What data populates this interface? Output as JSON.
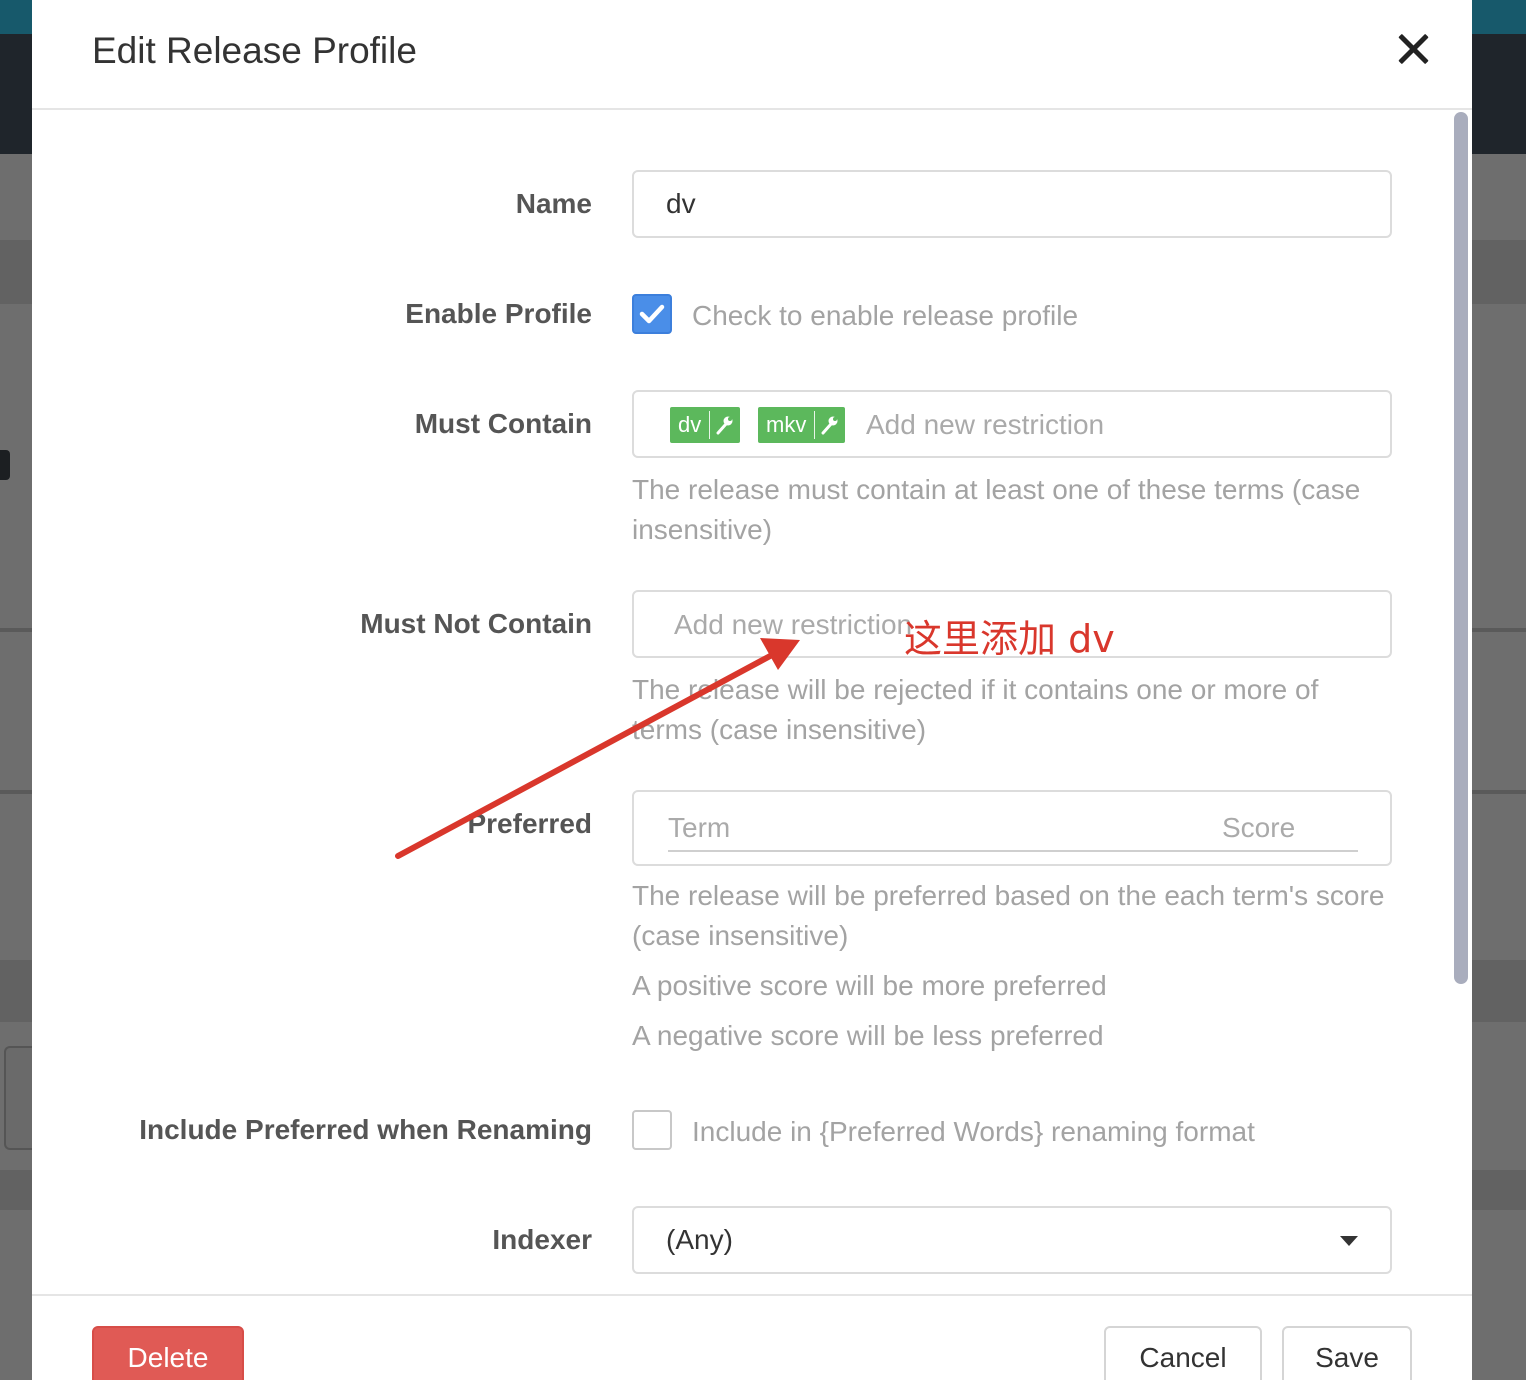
{
  "modal": {
    "title": "Edit Release Profile"
  },
  "form": {
    "name": {
      "label": "Name",
      "value": "dv"
    },
    "enable_profile": {
      "label": "Enable Profile",
      "checked": true,
      "help": "Check to enable release profile"
    },
    "must_contain": {
      "label": "Must Contain",
      "tags": [
        "dv",
        "mkv"
      ],
      "tag_icon": "wrench-icon",
      "placeholder": "Add new restriction",
      "help": "The release must contain at least one of these terms (case insensitive)"
    },
    "must_not_contain": {
      "label": "Must Not Contain",
      "placeholder": "Add new restriction",
      "help": "The release will be rejected if it contains one or more of terms (case insensitive)"
    },
    "preferred": {
      "label": "Preferred",
      "term_placeholder": "Term",
      "score_placeholder": "Score",
      "help": "The release will be preferred based on the each term's score (case insensitive)",
      "help_positive": "A positive score will be more preferred",
      "help_negative": "A negative score will be less preferred"
    },
    "include_preferred": {
      "label": "Include Preferred when Renaming",
      "checked": false,
      "help": "Include in {Preferred Words} renaming format"
    },
    "indexer": {
      "label": "Indexer",
      "value": "(Any)"
    }
  },
  "footer": {
    "delete_label": "Delete",
    "cancel_label": "Cancel",
    "save_label": "Save"
  },
  "annotation": {
    "text": "这里添加 dv",
    "color": "#d9372c"
  },
  "colors": {
    "tag_green": "#5cb85c",
    "checkbox_blue": "#4a8ee8",
    "delete_red": "#e05a55"
  }
}
